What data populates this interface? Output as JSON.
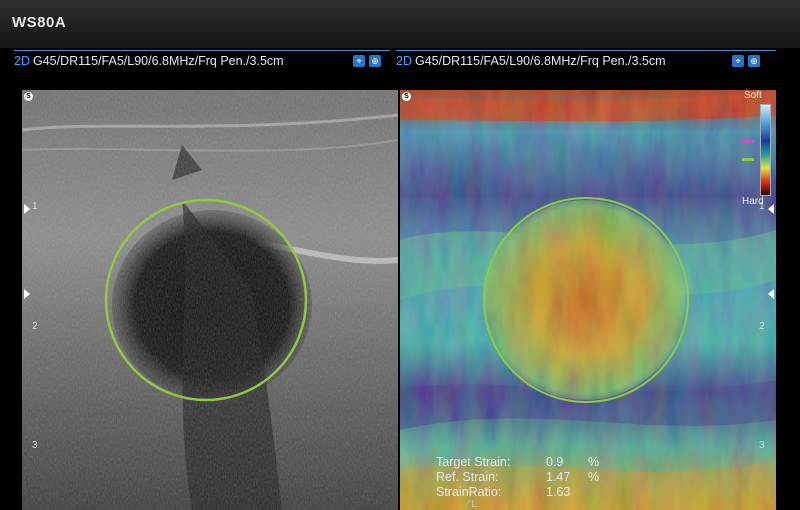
{
  "device": {
    "name": "WS80A"
  },
  "left_panel": {
    "mode": "2D",
    "params": "G45/DR115/FA5/L90/6.8MHz/Frq Pen./3.5cm",
    "depth_marks": [
      "1",
      "2",
      "3"
    ],
    "icon_names": [
      "probe-icon",
      "zoom-icon"
    ]
  },
  "right_panel": {
    "mode": "2D",
    "params": "G45/DR115/FA5/L90/6.8MHz/Frq Pen./3.5cm",
    "depth_marks": [
      "1",
      "2",
      "3"
    ],
    "icon_names": [
      "probe-icon",
      "zoom-icon"
    ]
  },
  "scale": {
    "soft_label": "Soft",
    "hard_label": "Hard"
  },
  "measurements": {
    "target_strain": {
      "label": "Target Strain:",
      "value": "0.9",
      "unit": "%"
    },
    "ref_strain": {
      "label": "Ref. Strain:",
      "value": "1.47",
      "unit": "%"
    },
    "strain_ratio": {
      "label": "StrainRatio:",
      "value": "1.63"
    }
  },
  "colors": {
    "roi_circle": "#8ecb3e",
    "accent": "#3a8fd8",
    "mode_text": "#49a2ff"
  }
}
